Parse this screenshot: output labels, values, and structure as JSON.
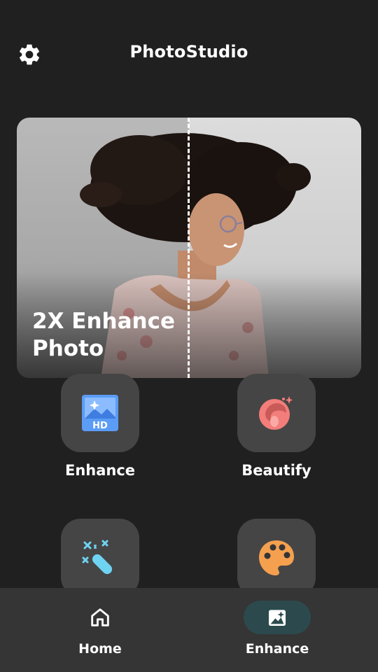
{
  "header": {
    "title": "PhotoStudio",
    "settings_icon": "gear-icon"
  },
  "hero": {
    "title": "2X Enhance Photo"
  },
  "tools": [
    {
      "label": "Enhance",
      "icon": "hd-image-icon",
      "color": "#5b9cf6"
    },
    {
      "label": "Beautify",
      "icon": "face-sparkle-icon",
      "color": "#f37d7a"
    },
    {
      "label": "",
      "icon": "magic-wand-icon",
      "color": "#6fd3f2"
    },
    {
      "label": "",
      "icon": "palette-icon",
      "color": "#f5a04f"
    }
  ],
  "nav": {
    "items": [
      {
        "label": "Home",
        "icon": "home-icon",
        "active": false
      },
      {
        "label": "Enhance",
        "icon": "enhance-image-icon",
        "active": true
      }
    ],
    "active_color": "#2c4a4d"
  }
}
